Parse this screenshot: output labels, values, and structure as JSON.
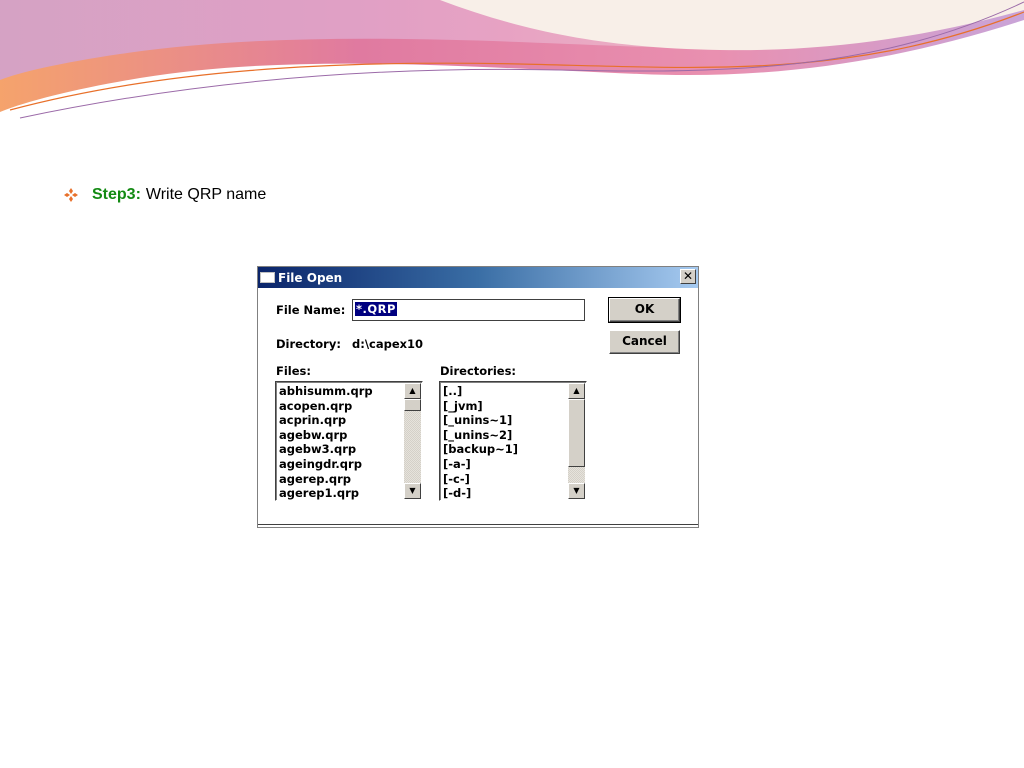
{
  "slide": {
    "step_label": "Step3:",
    "step_text": "Write QRP name",
    "accent_colors": {
      "step_label": "#138a13",
      "bullet": "#e8702a",
      "swoosh_pink": "#e07aa0",
      "swoosh_orange": "#f5a36c",
      "swoosh_lilac": "#c9a4d8"
    }
  },
  "dialog": {
    "title": "File Open",
    "close_glyph": "✕",
    "file_name_label": "File Name:",
    "file_name_value": "*.QRP",
    "directory_label": "Directory:",
    "directory_value": "d:\\capex10",
    "ok_label": "OK",
    "cancel_label": "Cancel",
    "files_label": "Files:",
    "directories_label": "Directories:",
    "files": [
      "abhisumm.qrp",
      "acopen.qrp",
      "acprin.qrp",
      "agebw.qrp",
      "agebw3.qrp",
      "ageingdr.qrp",
      "agerep.qrp",
      "agerep1.qrp"
    ],
    "directories": [
      "[..]",
      "[_jvm]",
      "[_unins~1]",
      "[_unins~2]",
      "[backup~1]",
      "[-a-]",
      "[-c-]",
      "[-d-]"
    ],
    "scroll_up_glyph": "▲",
    "scroll_down_glyph": "▼"
  }
}
